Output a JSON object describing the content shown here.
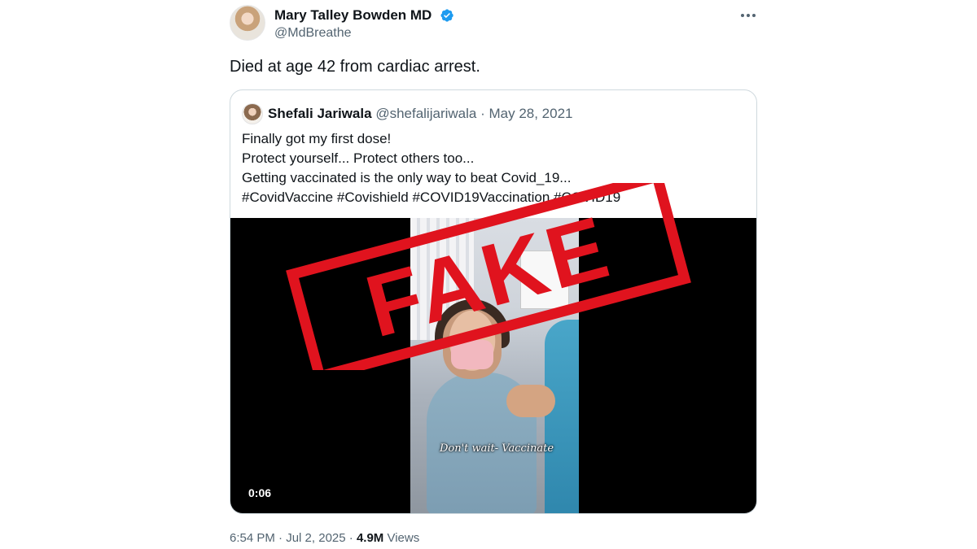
{
  "author": {
    "name": "Mary Talley Bowden MD",
    "handle": "@MdBreathe",
    "verified": true,
    "avatar_icon": "avatar-photo"
  },
  "tweet": {
    "text": "Died at age 42 from cardiac arrest."
  },
  "quoted_tweet": {
    "name": "Shefali Jariwala",
    "handle": "@shefalijariwala",
    "separator": "·",
    "date": "May 28, 2021",
    "text": "Finally got my first dose!\nProtect yourself... Protect others too...\nGetting vaccinated is the only way to beat Covid_19...\n#CovidVaccine #Covishield #COVID19Vaccination #COVID19",
    "video": {
      "caption": "Don't wait- Vaccinate",
      "duration": "0:06"
    }
  },
  "stamp": {
    "text": "FAKE",
    "color": "#e0131e"
  },
  "footer": {
    "time": "6:54 PM",
    "separator": "·",
    "date": "Jul 2, 2025",
    "separator2": "·",
    "views": "4.9M",
    "views_label": "Views"
  },
  "colors": {
    "verified_blue": "#1d9bf0",
    "secondary_text": "#536471",
    "border": "#cfd9de"
  }
}
